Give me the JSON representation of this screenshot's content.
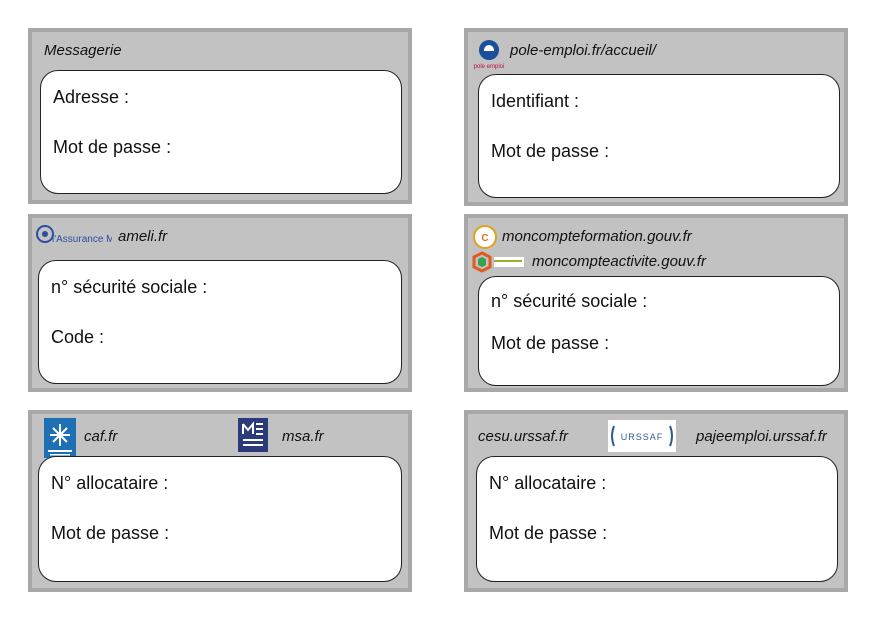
{
  "cards": [
    {
      "site": "Messagerie",
      "fields": [
        "Adresse :",
        "Mot de passe :"
      ]
    },
    {
      "site": "pole-emploi.fr/accueil/",
      "logo_text": "pole emploi",
      "fields": [
        "Identifiant :",
        "Mot de passe :"
      ]
    },
    {
      "site": "ameli.fr",
      "logo_text": "l'Assurance Maladie",
      "fields": [
        "n° sécurité sociale :",
        "Code :"
      ]
    },
    {
      "sites": [
        "moncompteformation.gouv.fr",
        "moncompteactivite.gouv.fr"
      ],
      "logo_text": "CPF",
      "fields": [
        "n° sécurité sociale :",
        "Mot de passe :"
      ]
    },
    {
      "sites": [
        "caf.fr",
        "msa.fr"
      ],
      "fields": [
        "N° allocataire :",
        "Mot de passe :"
      ]
    },
    {
      "sites": [
        "cesu.urssaf.fr",
        "pajeemploi.urssaf.fr"
      ],
      "logo_text": "URSSAF",
      "fields": [
        "N° allocataire :",
        "Mot de passe :"
      ]
    }
  ],
  "colors": {
    "card_bg": "#c2c2c2",
    "card_border": "#a8a8a8",
    "caf_blue": "#1f6fb5",
    "msa_navy": "#2a3a7a",
    "urssaf_blue": "#2f5f8f"
  }
}
